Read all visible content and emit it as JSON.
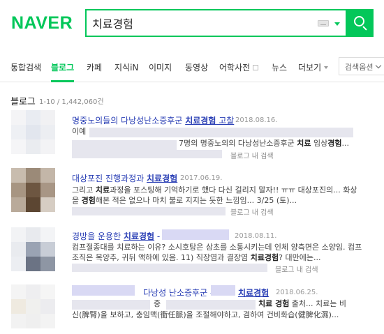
{
  "logo": "NAVER",
  "search": {
    "query": "치료경험"
  },
  "tabs": [
    {
      "label": "통합검색"
    },
    {
      "label": "블로그"
    },
    {
      "label": "카페"
    },
    {
      "label": "지식iN"
    },
    {
      "label": "이미지"
    },
    {
      "label": "동영상"
    },
    {
      "label": "어학사전"
    },
    {
      "label": "뉴스"
    },
    {
      "label": "더보기"
    }
  ],
  "search_options_label": "검색옵션",
  "section": {
    "title": "블로그",
    "count": "1-10 / 1,442,060건"
  },
  "results": [
    {
      "title_pre": "명중노의들의 다낭성난소증후군 ",
      "title_kw": "치료경험",
      "title_post": " 고찰",
      "date": "2018.08.16.",
      "line1_pre": "이예",
      "line2_pre": "7명의 명중노의의 다낭성난소증후군 ",
      "line2_kw": "치료",
      "line2_mid": " 임상",
      "line2_kw2": "경험",
      "line2_post": "...",
      "blog_label": "블로그 내 검색"
    },
    {
      "title_pre": "대상포진 진행과정과 ",
      "title_kw": "치료경험",
      "title_post": "",
      "date": "2017.06.19.",
      "line1_pre": "그리고 ",
      "line1_kw": "치료",
      "line1_post": "과정을 포스팅해 기억하기로 했다 다신 걸리지 말자!! ㅠㅠ 대상포진의... 화상",
      "line2_pre": "을 ",
      "line2_kw": "경험",
      "line2_post": "해본 적은 없으나 마치 불로 지지는 듯한 느낌임... 3/25 (토)...",
      "blog_label": "블로그 내 검색"
    },
    {
      "title_pre": "경방을 운용한 ",
      "title_kw": "치료경험",
      "title_post": " -",
      "date": "2018.08.11.",
      "line1_pre": "컴프절종대를 치료하는 이유? 소시호탕은 삼초를 소통시키는데 인체 양측면은 소양임. 컴프",
      "line2_pre": "조직은 목양추, 귀뒤 액하에 있음. 11) 직장염과 결장염 ",
      "line2_kw": "치료경험",
      "line2_post": "? 대만에는...",
      "blog_label": "블로그 내 검색"
    },
    {
      "title_pre": "다낭성 난소증후군 - ",
      "title_kw": "치료경험",
      "title_post": "",
      "date": "2018.06.25.",
      "line1_pre": "중",
      "line1_kw": "치료 경험",
      "line1_post": " 출처... 치료는 비",
      "line2_pre": "신(脾腎)을 보하고, 충임맥(衝任脈)을 조절해야하고, 겸하여 건비화습(健脾化濕)..."
    }
  ],
  "colors": {
    "brand": "#03c75a",
    "link": "#2a3fb5"
  }
}
